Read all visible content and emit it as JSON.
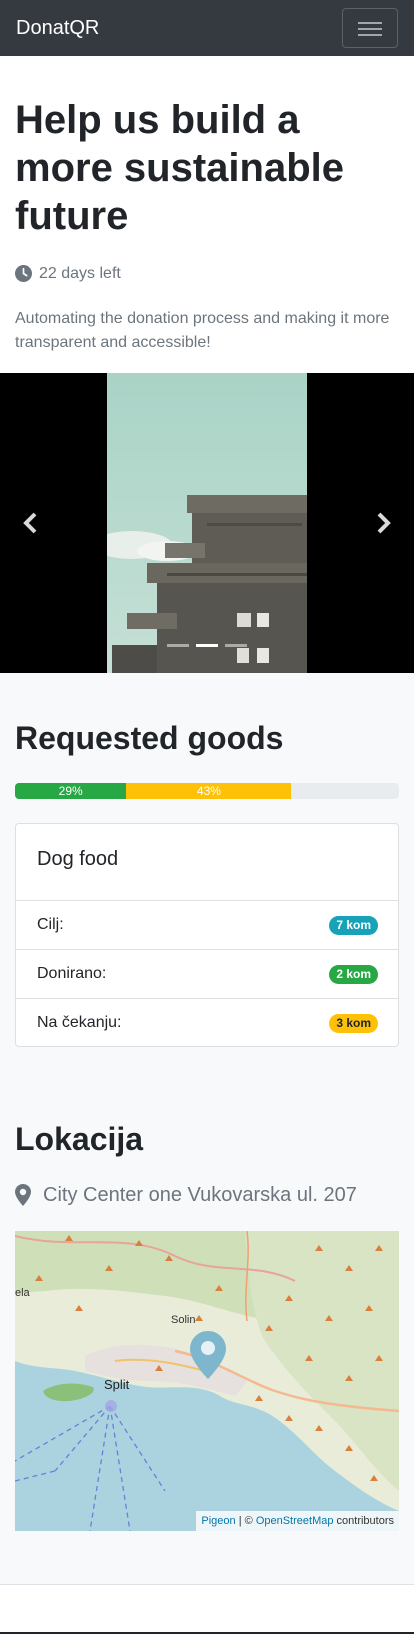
{
  "navbar": {
    "brand": "DonatQR",
    "toggle_icon": "hamburger-icon"
  },
  "hero": {
    "title": "Help us build a more sustainable future",
    "days_left": "22 days left",
    "lead": "Automating the donation process and making it more transparent and accessible!"
  },
  "carousel": {
    "prev_icon": "chevron-left-icon",
    "next_icon": "chevron-right-icon",
    "indicator_count": 3
  },
  "requested": {
    "title": "Requested goods",
    "progress": [
      {
        "label": "29%",
        "value": 29,
        "color": "#28a745"
      },
      {
        "label": "43%",
        "value": 43,
        "color": "#ffc107"
      }
    ],
    "item": {
      "name": "Dog food",
      "rows": [
        {
          "label": "Cilj:",
          "badge": "7 kom",
          "color": "#17a2b8",
          "text_color": "#ffffff"
        },
        {
          "label": "Donirano:",
          "badge": "2 kom",
          "color": "#28a745",
          "text_color": "#ffffff"
        },
        {
          "label": "Na čekanju:",
          "badge": "3 kom",
          "color": "#ffc107",
          "text_color": "#212529"
        }
      ]
    }
  },
  "location": {
    "title": "Lokacija",
    "address": "City Center one Vukovarska ul. 207",
    "map": {
      "labels": {
        "solin": "Solin",
        "split": "Split",
        "ela": "ela"
      },
      "attribution": {
        "provider": "Pigeon",
        "sep": " | © ",
        "osm": "OpenStreetMap",
        "suffix": " contributors"
      }
    }
  },
  "colors": {
    "navbar": "#343a40",
    "muted": "#6c757d",
    "link": "#0078a8"
  }
}
